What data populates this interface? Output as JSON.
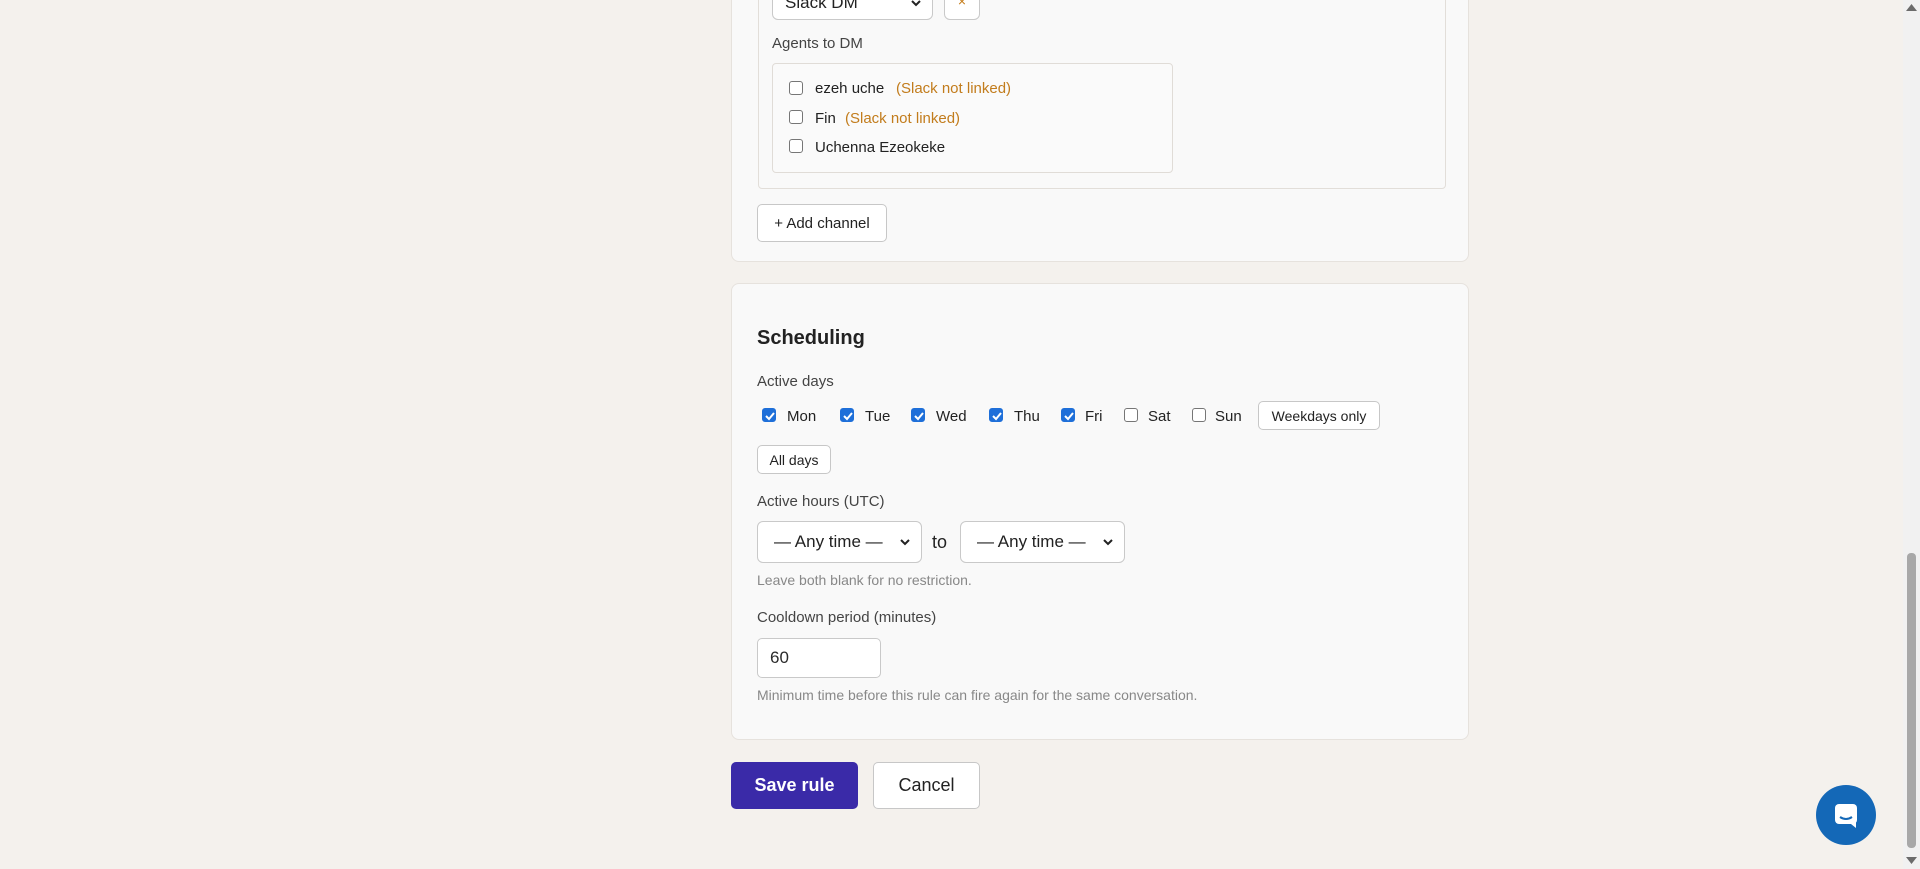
{
  "channel": {
    "type_select_value": "Slack DM",
    "remove_label": "×",
    "agents_label": "Agents to DM",
    "agents": [
      {
        "name": "ezeh uche",
        "note": "(Slack not linked)",
        "checked": false
      },
      {
        "name": "Fin",
        "note": "(Slack not linked)",
        "checked": false
      },
      {
        "name": "Uchenna Ezeokeke",
        "note": "",
        "checked": false
      }
    ],
    "add_channel_label": "+ Add channel"
  },
  "scheduling": {
    "title": "Scheduling",
    "active_days_label": "Active days",
    "days": [
      {
        "label": "Mon",
        "checked": true
      },
      {
        "label": "Tue",
        "checked": true
      },
      {
        "label": "Wed",
        "checked": true
      },
      {
        "label": "Thu",
        "checked": true
      },
      {
        "label": "Fri",
        "checked": true
      },
      {
        "label": "Sat",
        "checked": false
      },
      {
        "label": "Sun",
        "checked": false
      }
    ],
    "weekdays_only_label": "Weekdays only",
    "all_days_label": "All days",
    "active_hours_label": "Active hours (UTC)",
    "from_value": "— Any time —",
    "to_label": "to",
    "to_value": "— Any time —",
    "hours_help": "Leave both blank for no restriction.",
    "cooldown_label": "Cooldown period (minutes)",
    "cooldown_value": "60",
    "cooldown_help": "Minimum time before this rule can fire again for the same conversation."
  },
  "actions": {
    "save_label": "Save rule",
    "cancel_label": "Cancel"
  },
  "colors": {
    "primary": "#3a2aa8",
    "warning": "#c27c1c",
    "checkbox_checked": "#1e6fd9",
    "chat_launcher": "#1468b7"
  },
  "icons": {
    "chat": "chat-bubble-icon",
    "chevron": "chevron-down-icon"
  }
}
